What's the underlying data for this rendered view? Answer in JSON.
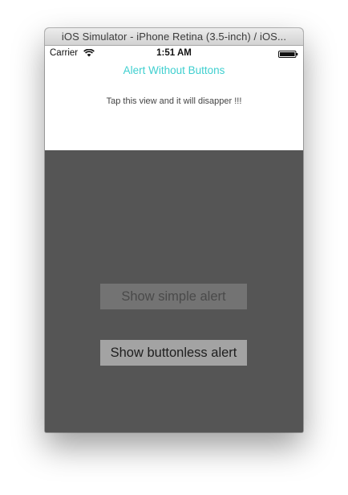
{
  "window": {
    "title": "iOS Simulator - iPhone Retina (3.5-inch) / iOS..."
  },
  "status_bar": {
    "carrier": "Carrier",
    "wifi_icon": "wifi-icon",
    "time": "1:51 AM",
    "battery_icon": "battery-icon"
  },
  "alert": {
    "title": "Alert Without Buttons",
    "message": "Tap this view and it will disapper !!!",
    "title_color": "#3fcfcf"
  },
  "buttons": {
    "simple_label": "Show simple alert",
    "buttonless_label": "Show buttonless alert"
  },
  "colors": {
    "background": "#555555",
    "panel": "#ffffff"
  }
}
